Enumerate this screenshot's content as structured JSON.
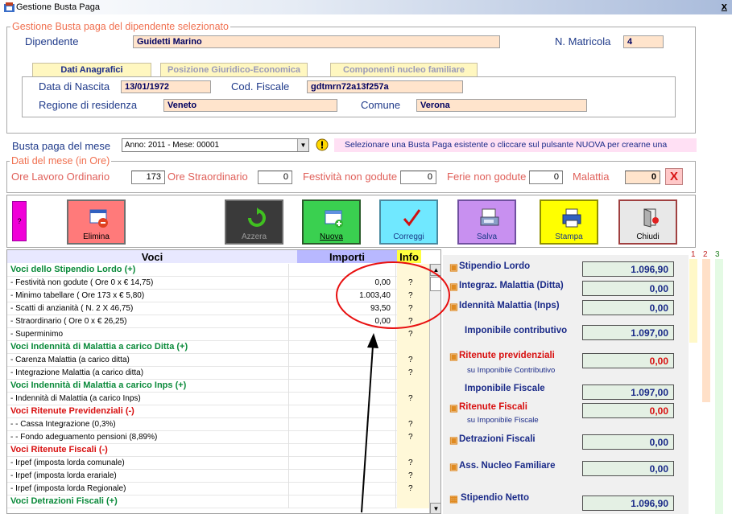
{
  "window": {
    "title": "Gestione Busta Paga",
    "close": "x"
  },
  "employee_group": {
    "legend": "Gestione Busta paga del dipendente selezionato",
    "dipendente_label": "Dipendente",
    "dipendente_value": "Guidetti Marino",
    "matricola_label": "N. Matricola",
    "matricola_value": "4",
    "tabs": [
      "Dati Anagrafici",
      "Posizione Giuridico-Economica",
      "Componenti nucleo familiare"
    ],
    "nascita_label": "Data di Nascita",
    "nascita_value": "13/01/1972",
    "cf_label": "Cod. Fiscale",
    "cf_value": "gdtmrn72a13f257a",
    "regione_label": "Regione di residenza",
    "regione_value": "Veneto",
    "comune_label": "Comune",
    "comune_value": "Verona"
  },
  "busta": {
    "label": "Busta paga del mese",
    "selected": "Anno: 2011 - Mese: 00001",
    "hint": "Selezionare una Busta Paga esistente  o cliccare sul pulsante NUOVA per crearne una"
  },
  "ore_group": {
    "legend": "Dati del mese (in Ore)",
    "ordinario_label": "Ore Lavoro Ordinario",
    "ordinario_value": "173",
    "straordinario_label": "Ore Straordinario",
    "straordinario_value": "0",
    "festivita_label": "Festività non godute",
    "festivita_value": "0",
    "ferie_label": "Ferie non godute",
    "ferie_value": "0",
    "malattia_label": "Malattia",
    "malattia_value": "0",
    "x_btn": "X"
  },
  "toolbar": {
    "help": "?",
    "elimina": "Elimina",
    "azzera": "Azzera",
    "nuova": "Nuova",
    "correggi": "Correggi",
    "salva": "Salva",
    "stampa": "Stampa",
    "chiudi": "Chiudi"
  },
  "grid": {
    "headers": {
      "voci": "Voci",
      "importi": "Importi",
      "info": "Info"
    },
    "rows": [
      {
        "voce": "Voci dello Stipendio Lordo (+)",
        "importo": "",
        "info": "",
        "kind": "sec"
      },
      {
        "voce": " - Festività non godute ( Ore 0 x  € 14,75)",
        "importo": "0,00",
        "info": "?",
        "kind": "item"
      },
      {
        "voce": " - Minimo tabellare ( Ore 173 x  € 5,80)",
        "importo": "1.003,40",
        "info": "?",
        "kind": "item"
      },
      {
        "voce": " - Scatti di anzianità ( N. 2 X 46,75)",
        "importo": "93,50",
        "info": "?",
        "kind": "item"
      },
      {
        "voce": " - Straordinario ( Ore 0 x  € 26,25)",
        "importo": "0,00",
        "info": "?",
        "kind": "item"
      },
      {
        "voce": " - Superminimo",
        "importo": "",
        "info": "?",
        "kind": "item"
      },
      {
        "voce": "Voci Indennità di Malattia a carico Ditta (+)",
        "importo": "",
        "info": "",
        "kind": "sec"
      },
      {
        "voce": " - Carenza Malattia (a carico ditta)",
        "importo": "",
        "info": "?",
        "kind": "item"
      },
      {
        "voce": " - Integrazione Malattia (a carico ditta)",
        "importo": "",
        "info": "?",
        "kind": "item"
      },
      {
        "voce": "Voci Indennità di Malattia a carico Inps (+)",
        "importo": "",
        "info": "",
        "kind": "sec"
      },
      {
        "voce": " - Indennità di Malattia (a carico Inps)",
        "importo": "",
        "info": "?",
        "kind": "item"
      },
      {
        "voce": "Voci Ritenute Previdenziali (-)",
        "importo": "",
        "info": "",
        "kind": "secred"
      },
      {
        "voce": " -   - Cassa Integrazione (0,3%)",
        "importo": "",
        "info": "?",
        "kind": "item"
      },
      {
        "voce": " -   - Fondo adeguamento pensioni (8,89%)",
        "importo": "",
        "info": "?",
        "kind": "item"
      },
      {
        "voce": "Voci Ritenute Fiscali (-)",
        "importo": "",
        "info": "",
        "kind": "secred"
      },
      {
        "voce": " - Irpef (imposta lorda comunale)",
        "importo": "",
        "info": "?",
        "kind": "item"
      },
      {
        "voce": " - Irpef (imposta lorda erariale)",
        "importo": "",
        "info": "?",
        "kind": "item"
      },
      {
        "voce": " - Irpef (imposta lorda Regionale)",
        "importo": "",
        "info": "?",
        "kind": "item"
      },
      {
        "voce": "Voci Detrazioni Fiscali (+)",
        "importo": "",
        "info": "",
        "kind": "sec"
      }
    ]
  },
  "summary": {
    "stipendio_lordo": {
      "label": "Stipendio Lordo",
      "value": "1.096,90"
    },
    "integraz_malattia": {
      "label": "Integraz. Malattia  (Ditta)",
      "value": "0,00"
    },
    "indennita_malattia": {
      "label": "Idennità Malattia  (Inps)",
      "value": "0,00"
    },
    "imponibile_contributivo": {
      "label": "Imponibile contributivo",
      "value": "1.097,00"
    },
    "ritenute_previdenziali": {
      "label": "Ritenute previdenziali",
      "sub": "su Imponibile Contributivo",
      "value": "0,00"
    },
    "imponibile_fiscale": {
      "label": "Imponibile Fiscale",
      "value": "1.097,00"
    },
    "ritenute_fiscali": {
      "label": "Ritenute Fiscali",
      "sub": "su Imponibile Fiscale",
      "value": "0,00"
    },
    "detrazioni_fiscali": {
      "label": "Detrazioni Fiscali",
      "value": "0,00"
    },
    "ass_nucleo": {
      "label": "Ass. Nucleo Familiare",
      "value": "0,00"
    },
    "stipendio_netto": {
      "label": "Stipendio Netto",
      "value": "1.096,90"
    }
  },
  "columns": {
    "labels": [
      "1",
      "2",
      "3"
    ]
  },
  "colors": {
    "accent_red": "#d81010",
    "label_blue": "#1f3a8a",
    "field_bg": "#ffe4cc",
    "tab_bg": "#fff7c0",
    "info_bg": "#fff8d8",
    "annotation": "#e81010"
  }
}
